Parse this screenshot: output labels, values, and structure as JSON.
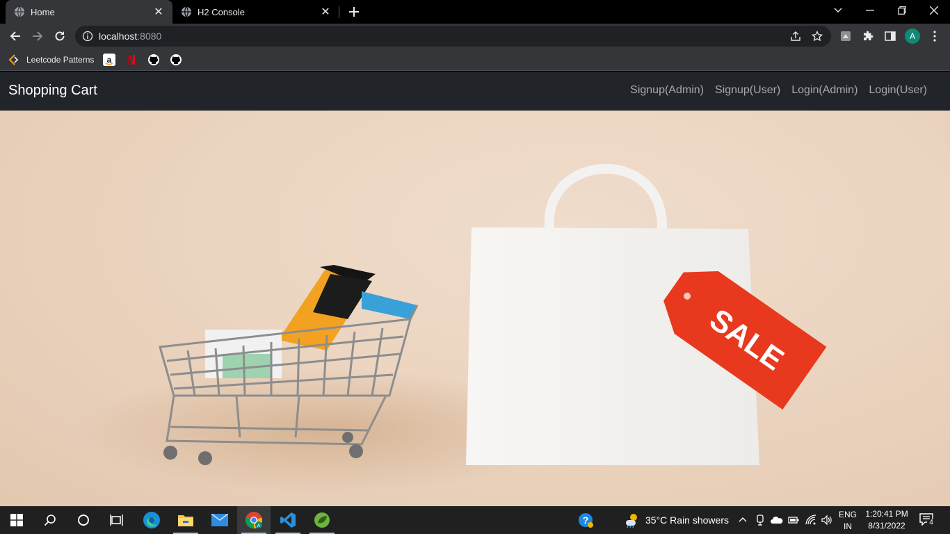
{
  "browser": {
    "tabs": [
      {
        "title": "Home",
        "active": true
      },
      {
        "title": "H2 Console",
        "active": false
      }
    ],
    "url_host": "localhost",
    "url_port": ":8080",
    "profile_initial": "A",
    "bookmarks": [
      {
        "label": "Leetcode Patterns",
        "icon": "leetcode-icon"
      },
      {
        "label": "",
        "icon": "amazon-icon"
      },
      {
        "label": "",
        "icon": "netflix-icon"
      },
      {
        "label": "",
        "icon": "github-icon"
      },
      {
        "label": "",
        "icon": "github-icon"
      }
    ]
  },
  "app": {
    "brand": "Shopping Cart",
    "nav": [
      "Signup(Admin)",
      "Signup(User)",
      "Login(Admin)",
      "Login(User)"
    ],
    "hero_tag_text": "SALE"
  },
  "taskbar": {
    "weather": "35°C  Rain showers",
    "lang_top": "ENG",
    "lang_bottom": "IN",
    "time": "1:20:41 PM",
    "date": "8/31/2022",
    "notifications": "4"
  },
  "colors": {
    "navbar": "#212529",
    "hero_bg": "#ecd6c2",
    "sale_tag": "#e8391e"
  }
}
